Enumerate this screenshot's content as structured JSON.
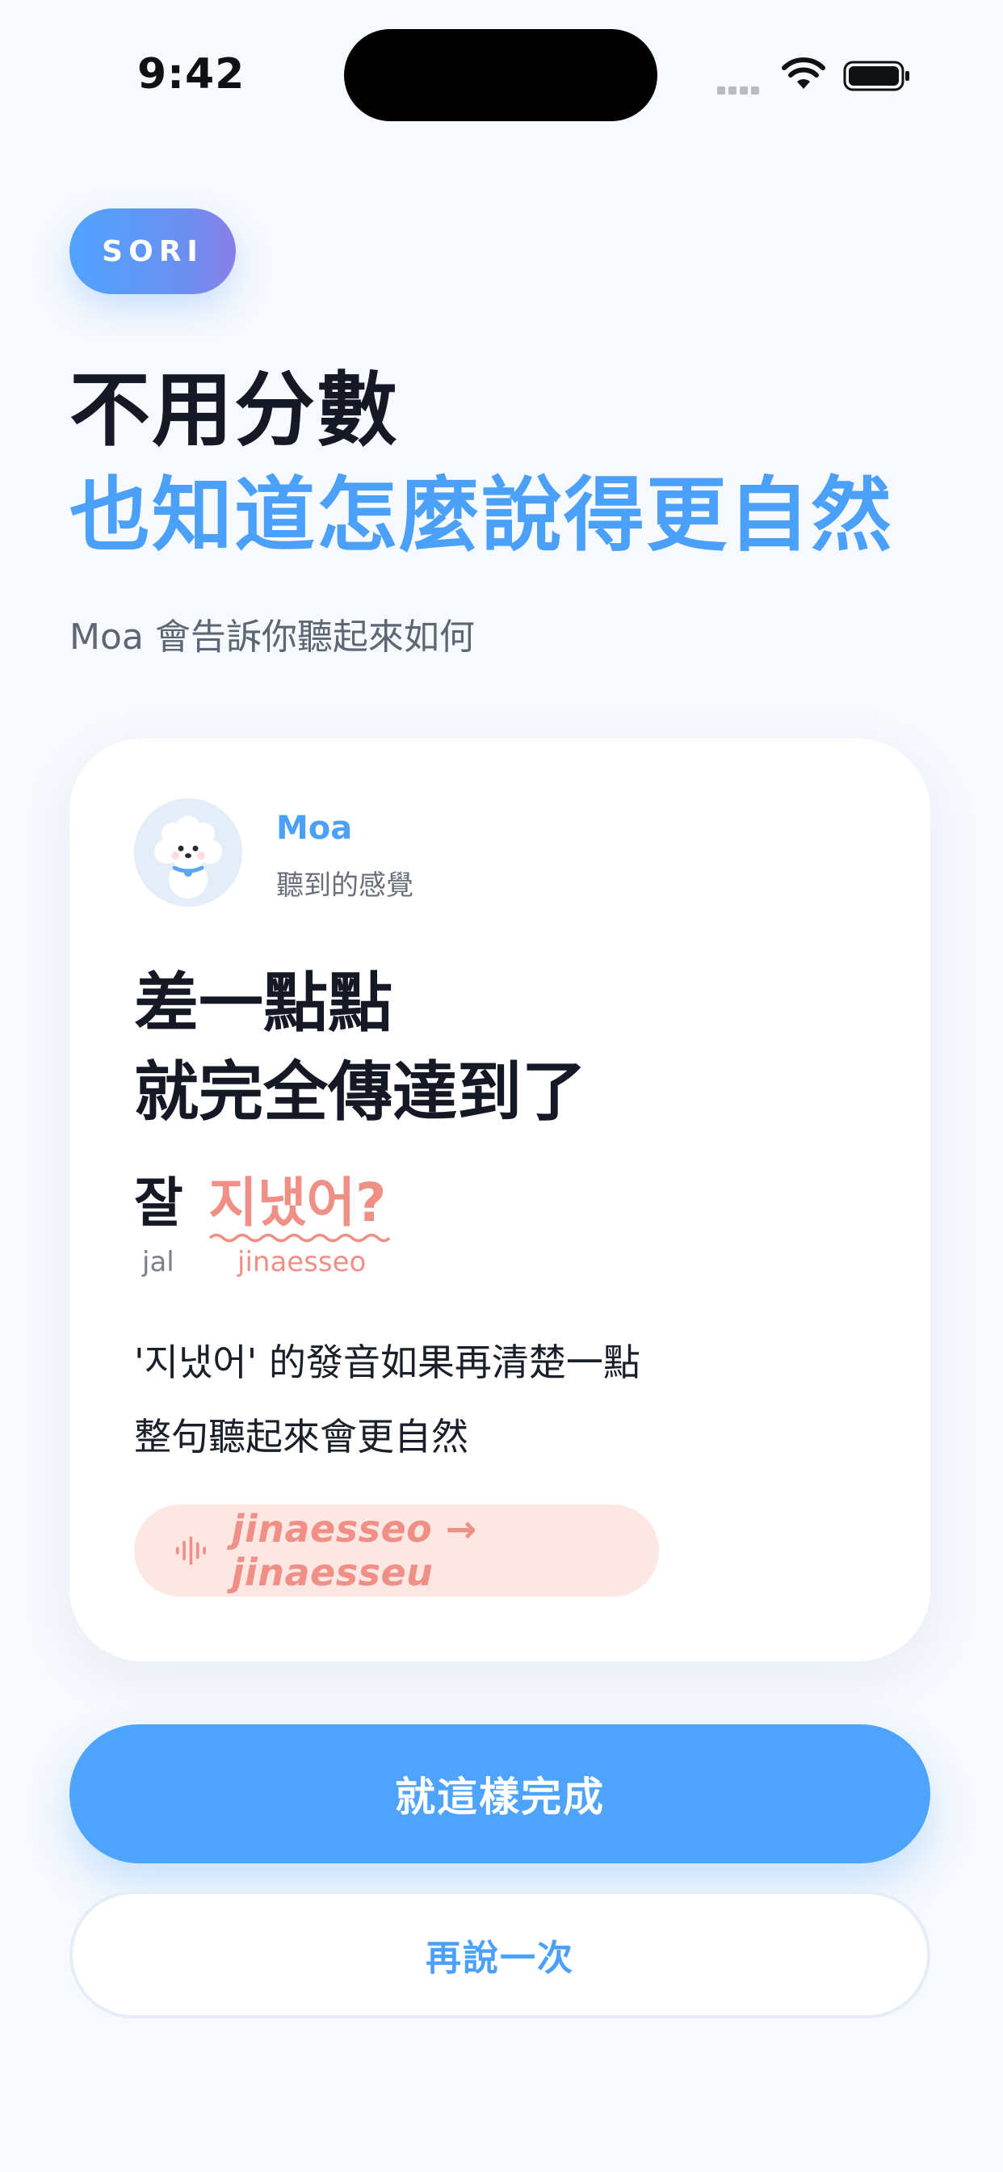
{
  "status_bar": {
    "time": "9:42"
  },
  "brand": {
    "label": "SORI"
  },
  "header": {
    "title_line1": "不用分數",
    "title_line2": "也知道怎麼說得更自然",
    "subtitle": "Moa 會告訴你聽起來如何"
  },
  "card": {
    "tutor_name": "Moa",
    "tutor_role": "聽到的感覺",
    "verdict_line1": "差一點點",
    "verdict_line2": "就完全傳達到了",
    "phrase": [
      {
        "word": "잘",
        "romanization": "jal"
      },
      {
        "word": "지냈어?",
        "romanization": "jinaesseo"
      }
    ],
    "explanation_line1": "'지냈어' 的發音如果再清楚一點",
    "explanation_line2": "整句聽起來會更自然",
    "correction": "jinaesseo → jinaesseu"
  },
  "actions": {
    "primary_label": "就這樣完成",
    "secondary_label": "再說一次"
  },
  "colors": {
    "accent_blue": "#4ea3fd",
    "highlight_coral": "#f08f86",
    "pill_bg": "#fde7e3"
  }
}
